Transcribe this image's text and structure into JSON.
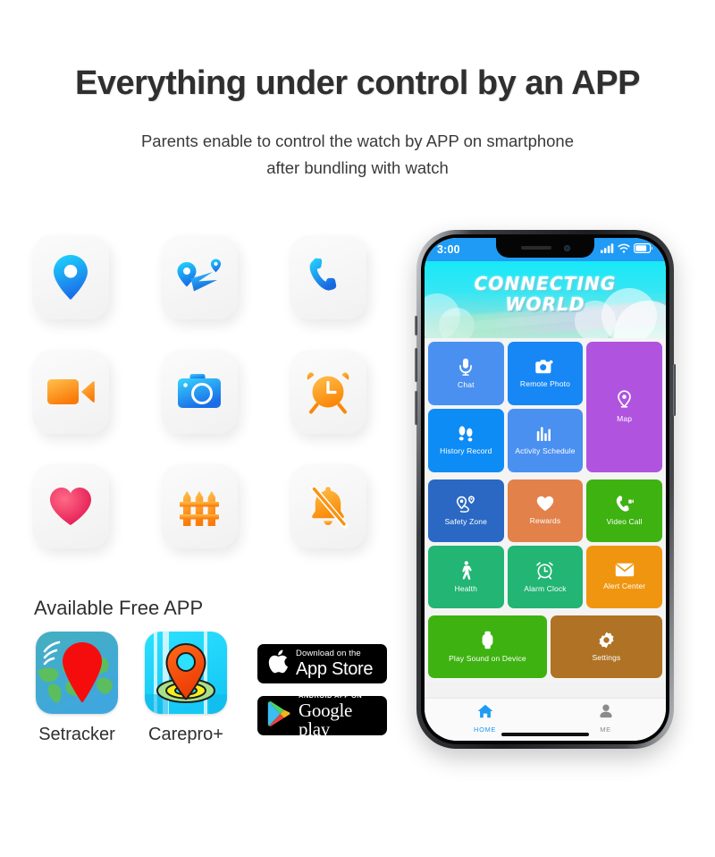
{
  "headline": "Everything under control by an APP",
  "subline": {
    "line1": "Parents enable to control the watch by APP on smartphone",
    "line2": "after bundling with watch"
  },
  "feature_icons": [
    {
      "name": "location-pin-icon",
      "label": "Location"
    },
    {
      "name": "route-map-icon",
      "label": "Route Map"
    },
    {
      "name": "phone-call-icon",
      "label": "Phone Call"
    },
    {
      "name": "video-camera-icon",
      "label": "Video"
    },
    {
      "name": "camera-icon",
      "label": "Camera"
    },
    {
      "name": "alarm-clock-icon",
      "label": "Alarm Clock"
    },
    {
      "name": "heart-icon",
      "label": "Health"
    },
    {
      "name": "fence-icon",
      "label": "Safety Fence"
    },
    {
      "name": "bell-muted-icon",
      "label": "Silent Mode"
    }
  ],
  "available_apps": {
    "title": "Available Free APP",
    "apps": [
      {
        "label": "Setracker",
        "icon": "setracker-app-icon"
      },
      {
        "label": "Carepro+",
        "icon": "carepro-app-icon"
      }
    ],
    "badges": {
      "appstore": {
        "small": "Download on the",
        "big": "App Store"
      },
      "googleplay": {
        "small": "ANDROID APP ON",
        "big": "Google play"
      }
    }
  },
  "phone": {
    "status_bar": {
      "time": "3:00",
      "signal": "signal-bars-icon",
      "wifi": "wifi-icon",
      "battery": "battery-icon"
    },
    "banner": {
      "line1": "CONNECTING",
      "line2": "WORLD"
    },
    "tiles_section_1": [
      {
        "label": "Chat",
        "icon": "microphone-icon",
        "color": "#4a90f0"
      },
      {
        "label": "Remote Photo",
        "icon": "camera-icon",
        "color": "#1787f5"
      },
      {
        "label": "Map",
        "icon": "map-pin-icon",
        "color": "#b054e0"
      },
      {
        "label": "History Record",
        "icon": "footsteps-icon",
        "color": "#0d8cf5"
      },
      {
        "label": "Activity Schedule",
        "icon": "bar-chart-icon",
        "color": "#4a90f0"
      }
    ],
    "tiles_section_2": [
      {
        "label": "Safety Zone",
        "icon": "geo-fence-icon",
        "color": "#2a68c4"
      },
      {
        "label": "Rewards",
        "icon": "heart-icon",
        "color": "#e2814a"
      },
      {
        "label": "Video Call",
        "icon": "video-call-icon",
        "color": "#3eb211"
      },
      {
        "label": "Health",
        "icon": "walking-icon",
        "color": "#22b573"
      },
      {
        "label": "Alarm Clock",
        "icon": "alarm-clock-icon",
        "color": "#22b573"
      },
      {
        "label": "Alert Center",
        "icon": "envelope-icon",
        "color": "#f0950f"
      }
    ],
    "tiles_section_3": [
      {
        "label": "Play Sound on Device",
        "icon": "watch-icon",
        "color": "#3eb211"
      },
      {
        "label": "Settings",
        "icon": "gear-icon",
        "color": "#b07224"
      }
    ],
    "tabbar": [
      {
        "label": "HOME",
        "icon": "home-icon",
        "active": true,
        "color": "#1f9bf5"
      },
      {
        "label": "ME",
        "icon": "person-icon",
        "active": false,
        "color": "#8b8b8b"
      }
    ]
  },
  "colors": {
    "accent_blue": "#1f9bf5",
    "banner_cyan": "#18e8f8",
    "text_dark": "#2f2f2f",
    "tile_bg": "#f4f4f4"
  }
}
